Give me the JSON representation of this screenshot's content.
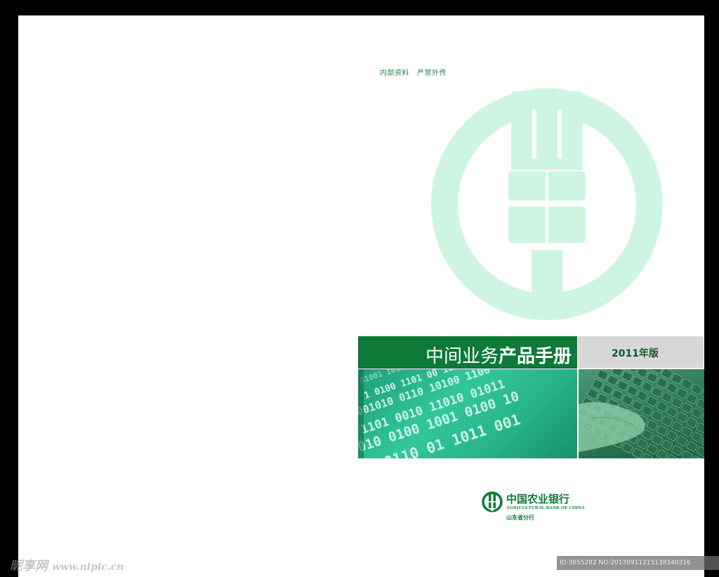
{
  "cover": {
    "confidential_note": "内部资料   严禁外传",
    "title_light": "中间业务",
    "title_bold": "产品手册",
    "edition": "2011年版"
  },
  "bank": {
    "name_cn": "中国农业银行",
    "name_en": "AGRICULTURAL BANK OF CHINA",
    "branch": "山东省分行"
  },
  "colors": {
    "brand_green": "#0d7a37",
    "logo_mint": "#cef5e1",
    "panel_teal": "#33c79b",
    "edition_grey": "#d7d7d7"
  },
  "images": {
    "binary_panel": "binary-digits-image",
    "keyboard_panel": "hand-on-keyboard-image"
  },
  "watermark": {
    "site": "昵享网",
    "url": "www.nipic.cn",
    "id_text": "ID:3655282 NO:20130911215138340316"
  }
}
